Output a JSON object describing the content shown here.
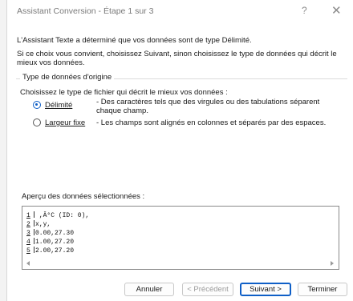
{
  "dialog": {
    "title": "Assistant Conversion - Étape 1 sur 3",
    "help_glyph": "?",
    "close_glyph": "✕"
  },
  "intro": {
    "line1": "L'Assistant Texte a déterminé que vos données sont de type Délimité.",
    "line2": "Si ce choix vous convient, choisissez Suivant, sinon choisissez le type de données qui décrit le mieux vos données."
  },
  "data_type": {
    "group_title": "Type de données d'origine",
    "choose_label": "Choisissez le type de fichier qui décrit le mieux vos données :",
    "options": [
      {
        "label": "Délimité",
        "description": "- Des caractères tels que des virgules ou des tabulations séparent chaque champ.",
        "selected": true
      },
      {
        "label": "Largeur fixe",
        "description": "- Les champs sont alignés en colonnes et séparés par des espaces.",
        "selected": false
      }
    ]
  },
  "preview": {
    "label": "Aperçu des données sélectionnées :",
    "rows": [
      {
        "num": "1",
        "text": " ,Â°C (ID: 0),"
      },
      {
        "num": "2",
        "text": "x,y,"
      },
      {
        "num": "3",
        "text": "0.00,27.30"
      },
      {
        "num": "4",
        "text": "1.00,27.20"
      },
      {
        "num": "5",
        "text": "2.00,27.20"
      }
    ]
  },
  "buttons": {
    "cancel": "Annuler",
    "previous": "< Précédent",
    "next": "Suivant >",
    "finish": "Terminer"
  },
  "colors": {
    "accent": "#0f5fc7",
    "border": "#c8c8c8"
  }
}
